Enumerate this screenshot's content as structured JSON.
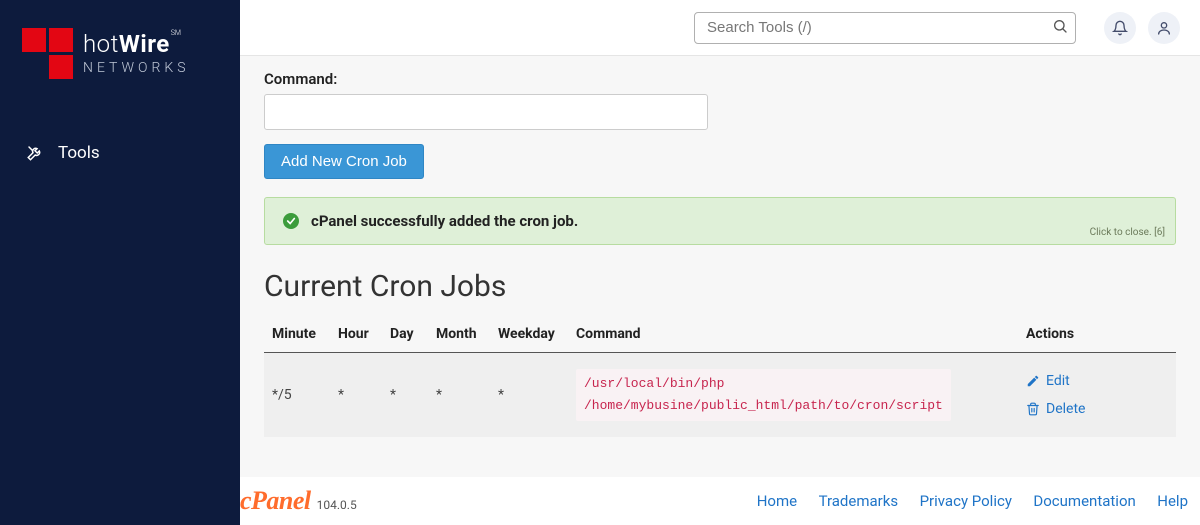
{
  "brand": {
    "name_part1": "hot",
    "name_part2": "Wire",
    "mark": "SM",
    "subline": "NETWORKS"
  },
  "sidebar": {
    "items": [
      {
        "label": "Tools"
      }
    ]
  },
  "search": {
    "placeholder": "Search Tools (/)"
  },
  "form": {
    "command_label": "Command:",
    "command_value": "",
    "submit_label": "Add New Cron Job"
  },
  "alert": {
    "message": "cPanel successfully added the cron job.",
    "close_hint": "Click to close. [6]"
  },
  "section_title": "Current Cron Jobs",
  "table": {
    "columns": {
      "minute": "Minute",
      "hour": "Hour",
      "day": "Day",
      "month": "Month",
      "weekday": "Weekday",
      "command": "Command",
      "actions": "Actions"
    },
    "rows": [
      {
        "minute": "*/5",
        "hour": "*",
        "day": "*",
        "month": "*",
        "weekday": "*",
        "command": "/usr/local/bin/php\n/home/mybusine/public_html/path/to/cron/script"
      }
    ],
    "actions": {
      "edit": "Edit",
      "delete": "Delete"
    }
  },
  "footer": {
    "product": "cPanel",
    "version": "104.0.5",
    "links": {
      "home": "Home",
      "trademarks": "Trademarks",
      "privacy": "Privacy Policy",
      "docs": "Documentation",
      "help": "Help"
    }
  }
}
